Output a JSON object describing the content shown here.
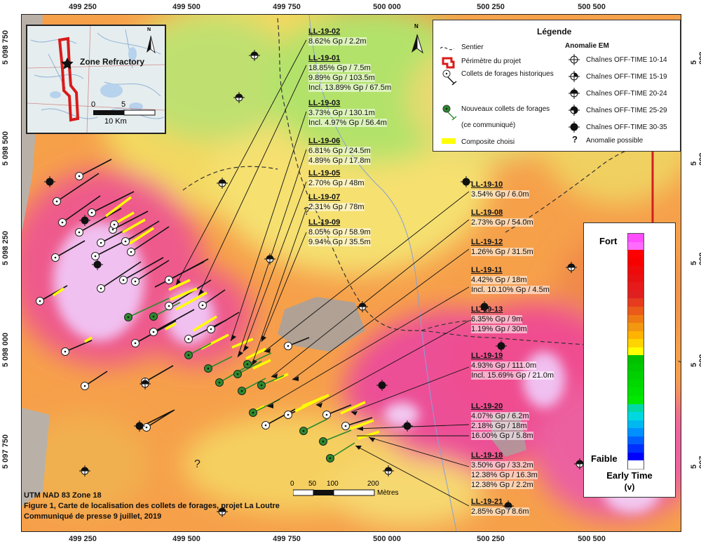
{
  "map": {
    "easting_ticks": [
      "499 250",
      "499 500",
      "499 750",
      "500 000",
      "500 250",
      "500 500"
    ],
    "northing_ticks": [
      "5 098 750",
      "5 098 500",
      "5 098 250",
      "5 098 000",
      "5 097 750"
    ],
    "footer": {
      "projection": "UTM NAD 83 Zone 18",
      "caption": "Figure 1, Carte de localisation des collets de forages, projet La Loutre",
      "press": "Communiqué de presse 9 juillet, 2019"
    },
    "scale_bar": {
      "labels": [
        "0",
        "50",
        "100",
        "200"
      ],
      "unit": "Mètres"
    },
    "north_label": "N",
    "question_mark": "?"
  },
  "inset": {
    "label": "Zone Refractory",
    "north_label": "N",
    "scale_labels": [
      "0",
      "5"
    ],
    "scale_unit": "10 Km"
  },
  "legend": {
    "title": "Légende",
    "items": [
      {
        "label": "Sentier"
      },
      {
        "label": "Périmètre du projet"
      },
      {
        "label": "Collets de forages historiques"
      },
      {
        "label": "Nouveaux collets de forages"
      },
      {
        "label": "(ce communiqué)"
      },
      {
        "label": "Composite choisi"
      }
    ],
    "em_title": "Anomalie EM",
    "em_items": [
      {
        "label": "Chaînes OFF-TIME 10-14"
      },
      {
        "label": "Chaînes OFF-TIME 15-19"
      },
      {
        "label": "Chaînes OFF-TIME 20-24"
      },
      {
        "label": "Chaînes OFF-TIME 25-29"
      },
      {
        "label": "Chaînes OFF-TIME 30-35"
      },
      {
        "label": "Anomalie possible"
      }
    ],
    "question_mark": "?"
  },
  "color_scale": {
    "top_label": "Fort",
    "bottom_label": "Faible",
    "title_line1": "Early Time",
    "title_line2": "(v)",
    "colors": [
      "#ff4dff",
      "#ff6bff",
      "#ff0000",
      "#f70000",
      "#ee0a0a",
      "#e81010",
      "#e61a1a",
      "#e02020",
      "#e63b1e",
      "#ea5b1a",
      "#ee7a14",
      "#f39610",
      "#ffb300",
      "#ffd400",
      "#ffff00",
      "#00c000",
      "#00c800",
      "#00d000",
      "#00d800",
      "#00e000",
      "#00e800",
      "#00d8a8",
      "#00d8e0",
      "#00b8f0",
      "#0090ff",
      "#0060ff",
      "#0030ff",
      "#0000ff",
      "#ffffff"
    ]
  },
  "holes": [
    {
      "id": "LL-19-02",
      "lines": [
        "8.62% Gp / 2.2m"
      ]
    },
    {
      "id": "LL-19-01",
      "lines": [
        "18.85% Gp / 7.5m",
        "9.89% Gp / 103.5m",
        "Incl. 13.89% Gp / 67.5m"
      ]
    },
    {
      "id": "LL-19-03",
      "lines": [
        "3.73% Gp / 130.1m",
        "Incl. 4.97% Gp / 56.4m"
      ]
    },
    {
      "id": "LL-19-06",
      "lines": [
        "6.81% Gp / 24.5m",
        "4.89% Gp / 17.8m"
      ]
    },
    {
      "id": "LL-19-05",
      "lines": [
        "2.70% Gp / 48m"
      ]
    },
    {
      "id": "LL-19-07",
      "lines": [
        "2.31% Gp / 78m"
      ]
    },
    {
      "id": "LL-19-09",
      "lines": [
        "8.05% Gp / 58.9m",
        "9.94% Gp / 35.5m"
      ]
    },
    {
      "id": "LL-19-10",
      "lines": [
        "3.54% Gp / 6.0m"
      ]
    },
    {
      "id": "LL-19-08",
      "lines": [
        "2.73% Gp / 54.0m"
      ]
    },
    {
      "id": "LL-19-12",
      "lines": [
        "1.26% Gp / 31.5m"
      ]
    },
    {
      "id": "LL-19-11",
      "lines": [
        "4.42% Gp / 18m",
        "Incl. 10.10% Gp / 4.5m"
      ]
    },
    {
      "id": "LL-19-13",
      "lines": [
        "6.35% Gp / 9m",
        "1.19% Gp / 30m"
      ]
    },
    {
      "id": "LL-19-19",
      "lines": [
        "4.93% Gp / 111.0m",
        "Incl. 15.69% Gp / 21.0m"
      ]
    },
    {
      "id": "LL-19-20",
      "lines": [
        "4.07% Gp / 6.2m",
        "2.18% Gp / 18m",
        "16.00% Gp / 5.8m"
      ]
    },
    {
      "id": "LL-19-18",
      "lines": [
        "3.50% Gp / 33.2m",
        "12.38% Gp / 16.3m",
        "12.38% Gp / 2.2m"
      ]
    },
    {
      "id": "LL-19-21",
      "lines": [
        "2.85% Gp / 8.6m"
      ]
    }
  ]
}
